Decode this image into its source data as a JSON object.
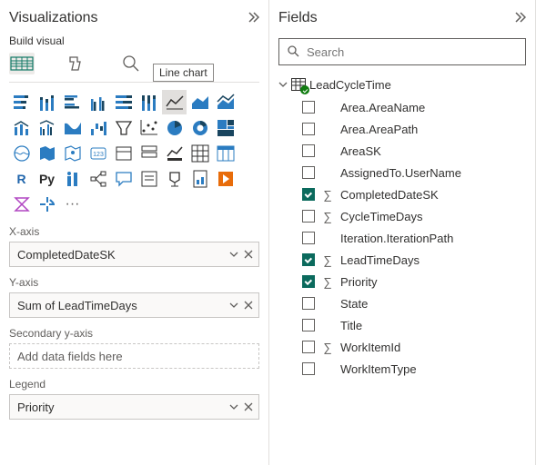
{
  "viz": {
    "title": "Visualizations",
    "build_label": "Build visual",
    "tooltip": "Line chart",
    "sections": {
      "xaxis": {
        "label": "X-axis",
        "value": "CompletedDateSK"
      },
      "yaxis": {
        "label": "Y-axis",
        "value": "Sum of LeadTimeDays"
      },
      "sec_yaxis": {
        "label": "Secondary y-axis",
        "placeholder": "Add data fields here"
      },
      "legend": {
        "label": "Legend",
        "value": "Priority"
      }
    },
    "icons": {
      "r": "R",
      "py": "Py",
      "more": "···"
    }
  },
  "fields": {
    "title": "Fields",
    "search_placeholder": "Search",
    "table": "LeadCycleTime",
    "items": [
      {
        "name": "Area.AreaName",
        "checked": false,
        "sigma": false
      },
      {
        "name": "Area.AreaPath",
        "checked": false,
        "sigma": false
      },
      {
        "name": "AreaSK",
        "checked": false,
        "sigma": false
      },
      {
        "name": "AssignedTo.UserName",
        "checked": false,
        "sigma": false
      },
      {
        "name": "CompletedDateSK",
        "checked": true,
        "sigma": true
      },
      {
        "name": "CycleTimeDays",
        "checked": false,
        "sigma": true
      },
      {
        "name": "Iteration.IterationPath",
        "checked": false,
        "sigma": false
      },
      {
        "name": "LeadTimeDays",
        "checked": true,
        "sigma": true
      },
      {
        "name": "Priority",
        "checked": true,
        "sigma": true
      },
      {
        "name": "State",
        "checked": false,
        "sigma": false
      },
      {
        "name": "Title",
        "checked": false,
        "sigma": false
      },
      {
        "name": "WorkItemId",
        "checked": false,
        "sigma": true
      },
      {
        "name": "WorkItemType",
        "checked": false,
        "sigma": false
      }
    ]
  }
}
